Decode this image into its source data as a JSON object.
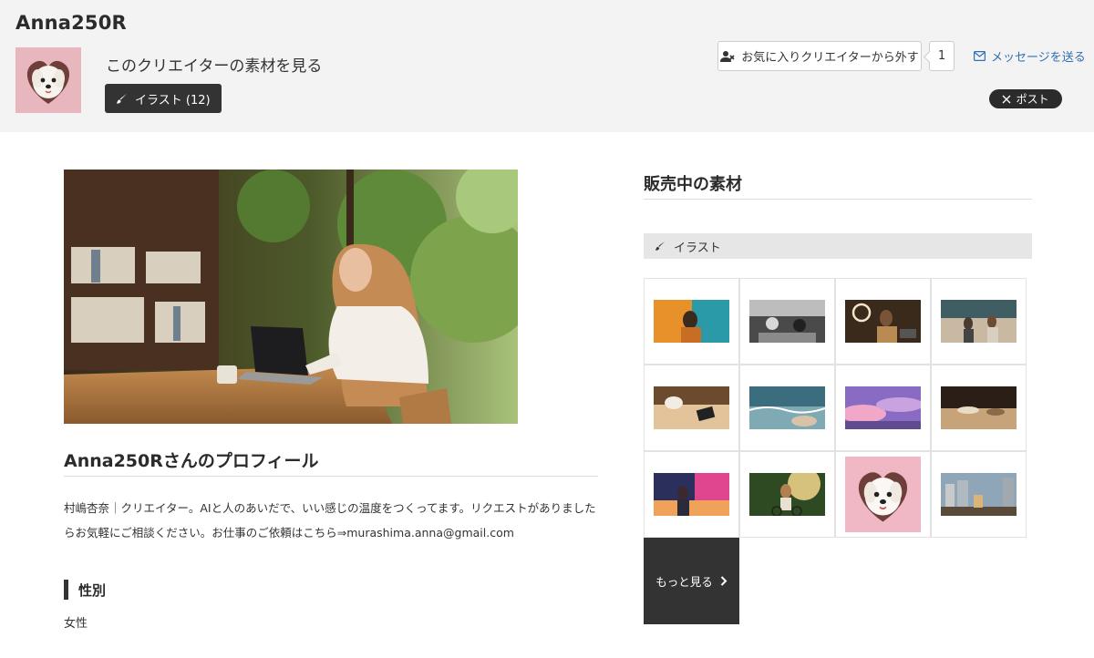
{
  "header": {
    "creator_name": "Anna250R",
    "view_materials": "このクリエイターの素材を見る",
    "illust_button": "イラスト (12)",
    "favorite_button": "お気に入りクリエイターから外す",
    "favorite_count": "1",
    "message_link": "メッセージを送る",
    "post_button": "ポスト"
  },
  "profile": {
    "title": "Anna250Rさんのプロフィール",
    "text": "村嶋杏奈｜クリエイター。AIと人のあいだで、いい感じの温度をつくってます。リクエストがありましたらお気軽にご相談ください。お仕事のご依頼はこちら⇒murashima.anna@gmail.com",
    "gender_heading": "性別",
    "gender_value": "女性"
  },
  "sale": {
    "title": "販売中の素材",
    "category": "イラスト",
    "more_button": "もっと見る"
  },
  "thumbnails": [
    {
      "name": "thumb-man-orange-teal",
      "colors": [
        "#e8902a",
        "#2a9aa8"
      ]
    },
    {
      "name": "thumb-cafe-monochrome",
      "colors": [
        "#2c2c2c",
        "#bdbdbd"
      ]
    },
    {
      "name": "thumb-woman-ring-light",
      "colors": [
        "#3a2a1c",
        "#b98a52"
      ]
    },
    {
      "name": "thumb-station-women",
      "colors": [
        "#3f5e63",
        "#c9b9a3"
      ]
    },
    {
      "name": "thumb-coffee-phone",
      "colors": [
        "#6b4a2e",
        "#e2c39a"
      ]
    },
    {
      "name": "thumb-beach-waves",
      "colors": [
        "#3b6d7f",
        "#d9c3a8"
      ]
    },
    {
      "name": "thumb-pink-clouds",
      "colors": [
        "#8a6bc4",
        "#f1a7c7"
      ]
    },
    {
      "name": "thumb-kitchen-cooking",
      "colors": [
        "#2a1e16",
        "#c7a37a"
      ]
    },
    {
      "name": "thumb-neon-city",
      "colors": [
        "#2b2f5c",
        "#e0468f"
      ]
    },
    {
      "name": "thumb-cyclist-forest",
      "colors": [
        "#2e4a22",
        "#d7c27d"
      ]
    },
    {
      "name": "thumb-dog-heart",
      "colors": [
        "#f0b7c4",
        "#ffffff"
      ]
    },
    {
      "name": "thumb-balcony-city",
      "colors": [
        "#8fa6b8",
        "#d9b57a"
      ]
    }
  ]
}
